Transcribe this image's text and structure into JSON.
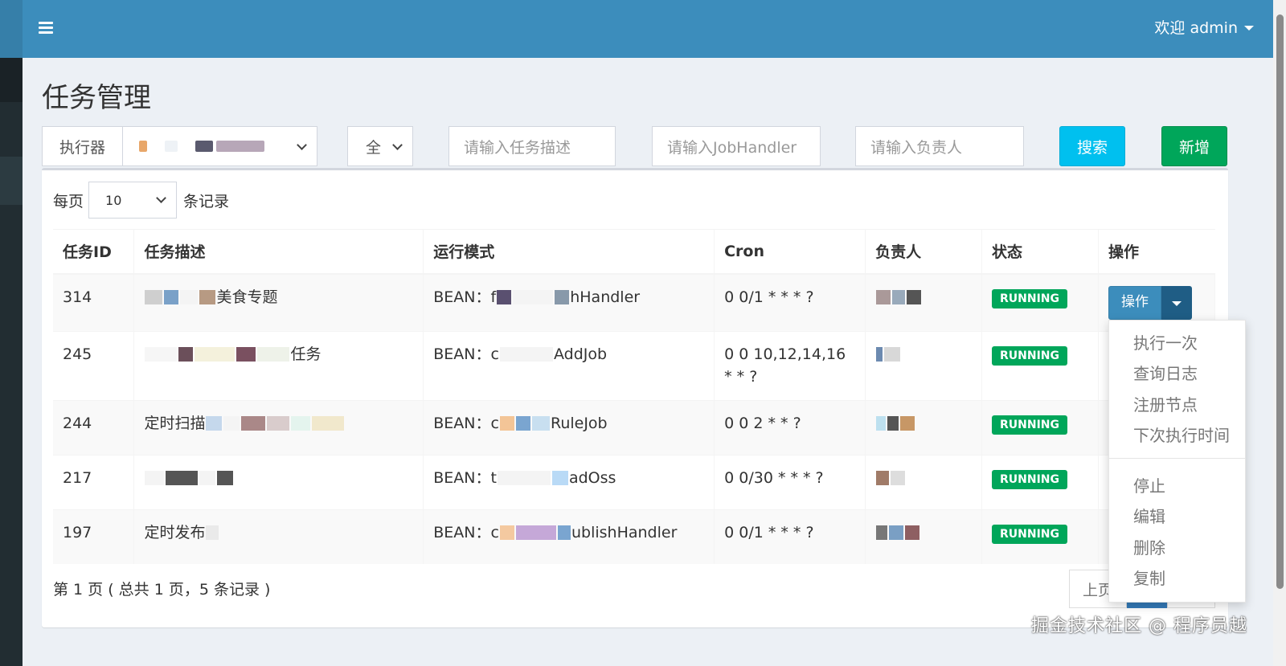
{
  "header": {
    "welcome_text": "欢迎 admin"
  },
  "page": {
    "title": "任务管理"
  },
  "filters": {
    "executor_label": "执行器",
    "executor_value": "",
    "status_value": "全",
    "job_desc_placeholder": "请输入任务描述",
    "handler_placeholder": "请输入JobHandler",
    "author_placeholder": "请输入负责人",
    "search_label": "搜索",
    "add_label": "新增"
  },
  "pagesize": {
    "prefix": "每页",
    "value": "10",
    "suffix": "条记录"
  },
  "table": {
    "columns": [
      "任务ID",
      "任务描述",
      "运行模式",
      "Cron",
      "负责人",
      "状态",
      "操作"
    ],
    "rows": [
      {
        "id": "314",
        "desc": "美食专题",
        "mode_prefix": "BEAN：f",
        "mode_suffix": "hHandler",
        "cron": "0 0/1 * * * ?",
        "author": "",
        "status": "RUNNING"
      },
      {
        "id": "245",
        "desc": "任务",
        "mode_prefix": "BEAN：c",
        "mode_suffix": "AddJob",
        "cron": "0 0 10,12,14,16 * * ?",
        "author": "",
        "status": "RUNNING"
      },
      {
        "id": "244",
        "desc": "定时扫描",
        "mode_prefix": "BEAN：c",
        "mode_suffix": "RuleJob",
        "cron": "0 0 2 * * ?",
        "author": "",
        "status": "RUNNING"
      },
      {
        "id": "217",
        "desc": "",
        "mode_prefix": "BEAN：t",
        "mode_suffix": "adOss",
        "cron": "0 0/30 * * * ?",
        "author": "",
        "status": "RUNNING"
      },
      {
        "id": "197",
        "desc": "定时发布",
        "mode_prefix": "BEAN：c",
        "mode_suffix": "ublishHandler",
        "cron": "0 0/1 * * * ?",
        "author": "",
        "status": "RUNNING"
      }
    ],
    "op_label": "操作"
  },
  "footer": {
    "info": "第 1 页 ( 总共 1 页，5 条记录 )",
    "prev_label": "上页"
  },
  "dropdown": {
    "items_top": [
      "执行一次",
      "查询日志",
      "注册节点",
      "下次执行时间"
    ],
    "items_bottom": [
      "停止",
      "编辑",
      "删除",
      "复制"
    ]
  },
  "watermark": "掘金技术社区 @ 程序员越",
  "colors": {
    "topbar": "#3c8dbc",
    "sidebar": "#222d32",
    "running": "#00a65a",
    "search_btn": "#00c0ef",
    "add_btn": "#00a65a",
    "op_btn": "#3c8dbc"
  },
  "icons": {
    "menu_toggle": "hamburger-icon",
    "user_caret": "caret-down-icon",
    "select_chevron": "chevron-down-icon"
  }
}
